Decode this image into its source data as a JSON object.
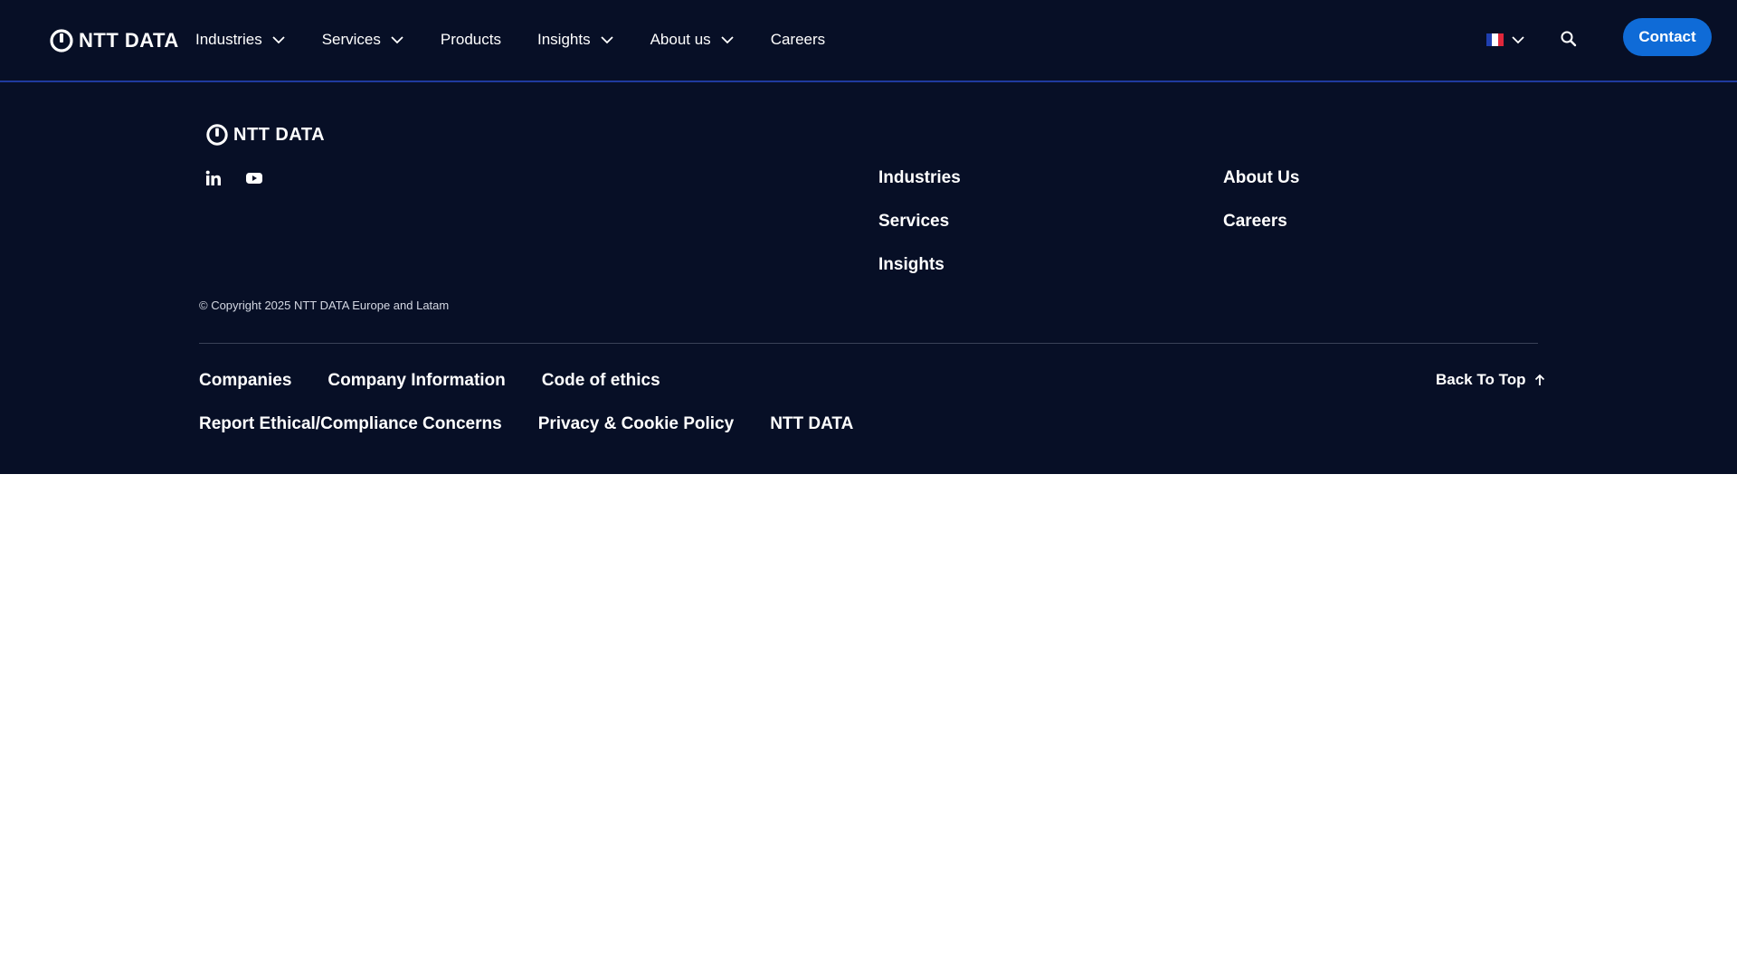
{
  "header": {
    "logo_text": "NTT DATA",
    "nav": [
      {
        "label": "Industries"
      },
      {
        "label": "Services"
      },
      {
        "label": "Products"
      },
      {
        "label": "Insights"
      },
      {
        "label": "About us"
      },
      {
        "label": "Careers"
      }
    ],
    "contact_label": "Contact",
    "flag_colors": [
      "#1f3fb0",
      "#ffffff",
      "#e0273b"
    ]
  },
  "footer": {
    "logo_text": "NTT DATA",
    "social": [
      "linkedin-icon",
      "youtube-icon"
    ],
    "col1": [
      "Industries",
      "Services",
      "Insights"
    ],
    "col2": [
      "About Us",
      "Careers"
    ],
    "copyright": "© Copyright 2025 NTT DATA Europe and Latam",
    "legal": [
      "Companies",
      "Company Information",
      "Code of ethics",
      "Report Ethical/Compliance Concerns",
      "Privacy & Cookie Policy",
      "NTT DATA"
    ],
    "back_to_top": "Back To Top"
  },
  "colors": {
    "background": "#070f26",
    "accent": "#0f6bd7"
  }
}
